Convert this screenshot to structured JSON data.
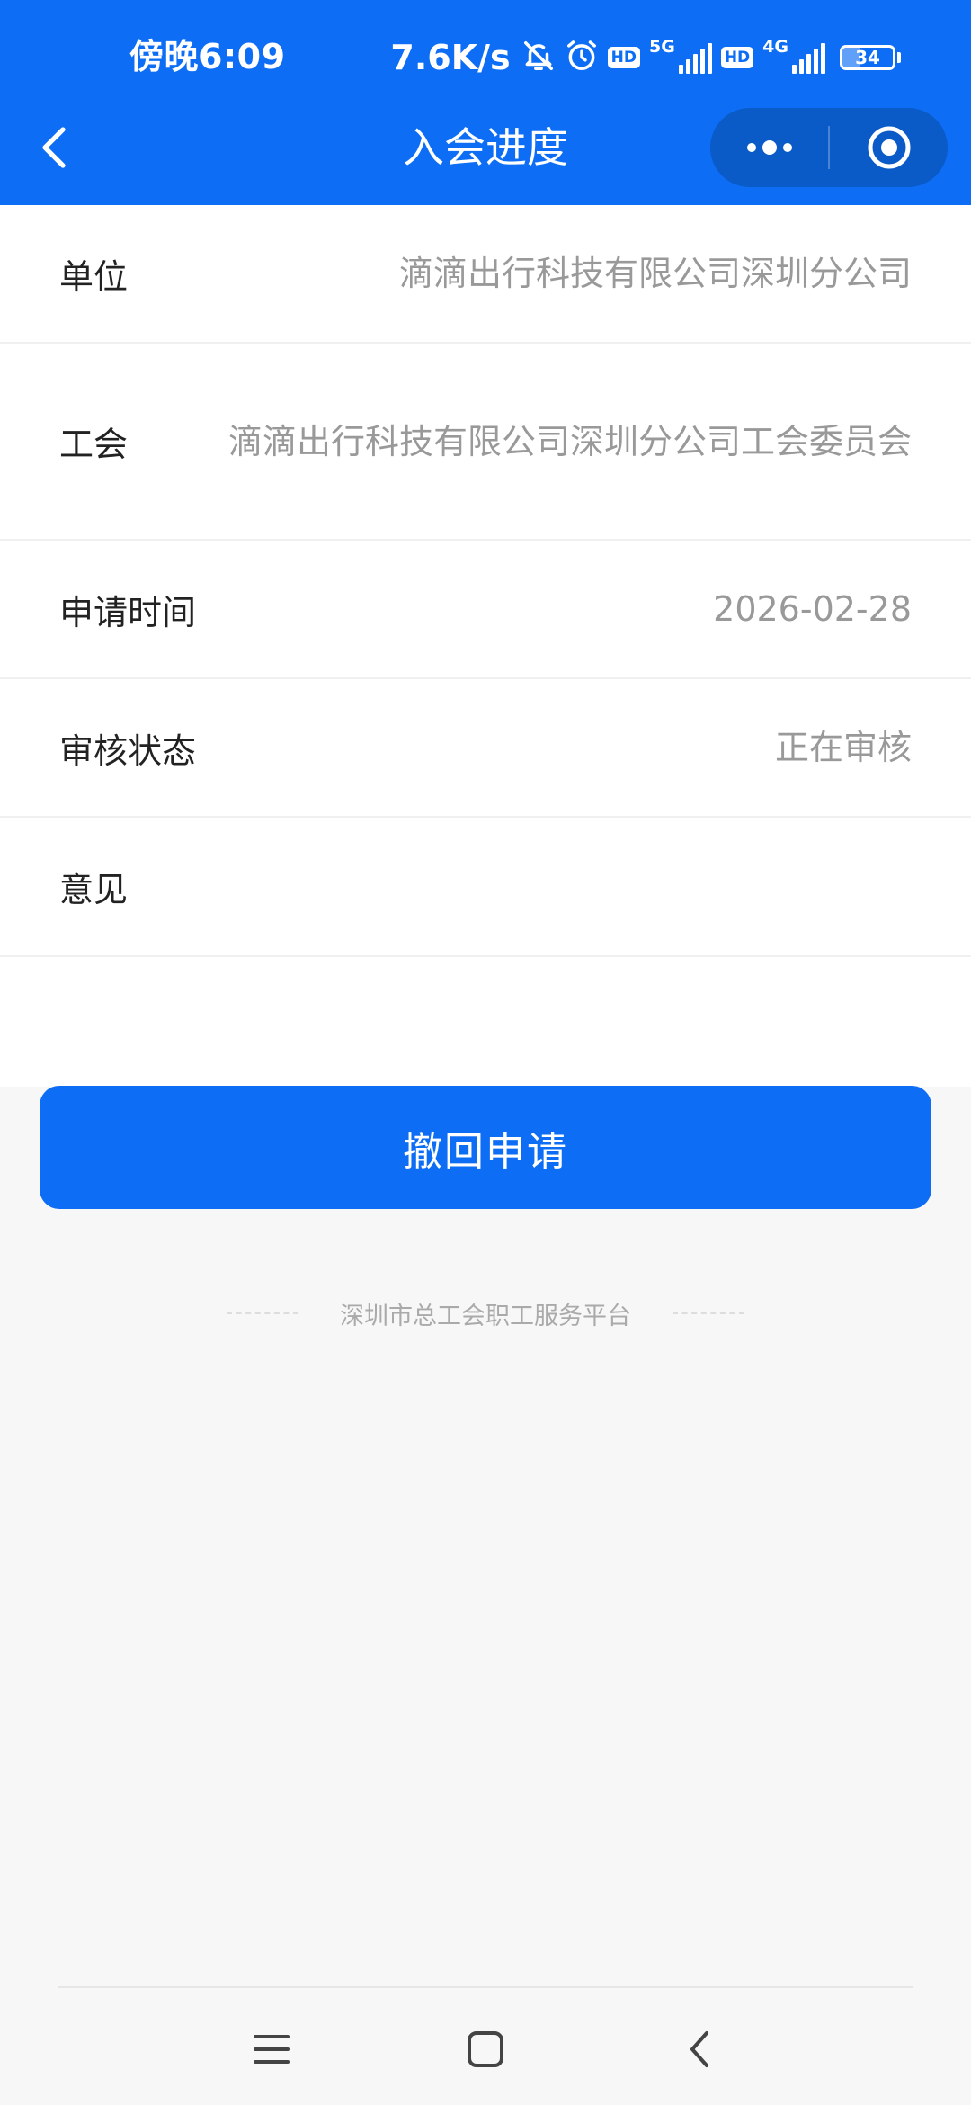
{
  "status_bar": {
    "time": "傍晚6:09",
    "net_speed": "7.6K/s",
    "hd_label_1": "HD",
    "network_1": "5G",
    "hd_label_2": "HD",
    "network_2": "4G",
    "battery": "34",
    "battery_level": 0.34,
    "icons": [
      "bell-off-icon",
      "alarm-icon",
      "signal-5g-icon",
      "signal-4g-icon",
      "battery-icon"
    ]
  },
  "nav": {
    "title": "入会进度",
    "back_icon": "chevron-left-icon",
    "more_icon": "more-dots-icon",
    "close_icon": "target-circle-icon"
  },
  "details": [
    {
      "label": "单位",
      "value": "滴滴出行科技有限公司深圳分公司"
    },
    {
      "label": "工会",
      "value": "滴滴出行科技有限公司深圳分公司工会委员会"
    },
    {
      "label": "申请时间",
      "value": "2026-02-28"
    },
    {
      "label": "审核状态",
      "value": "正在审核"
    },
    {
      "label": "意见",
      "value": ""
    }
  ],
  "actions": {
    "withdraw_label": "撤回申请"
  },
  "footer": {
    "brand": "深圳市总工会职工服务平台"
  },
  "system_nav": {
    "icons": [
      "menu-icon",
      "home-icon",
      "back-icon"
    ]
  },
  "colors": {
    "primary": "#0d6ef5",
    "background": "#f7f7f7",
    "label_text": "#222222",
    "value_text": "#999999"
  }
}
